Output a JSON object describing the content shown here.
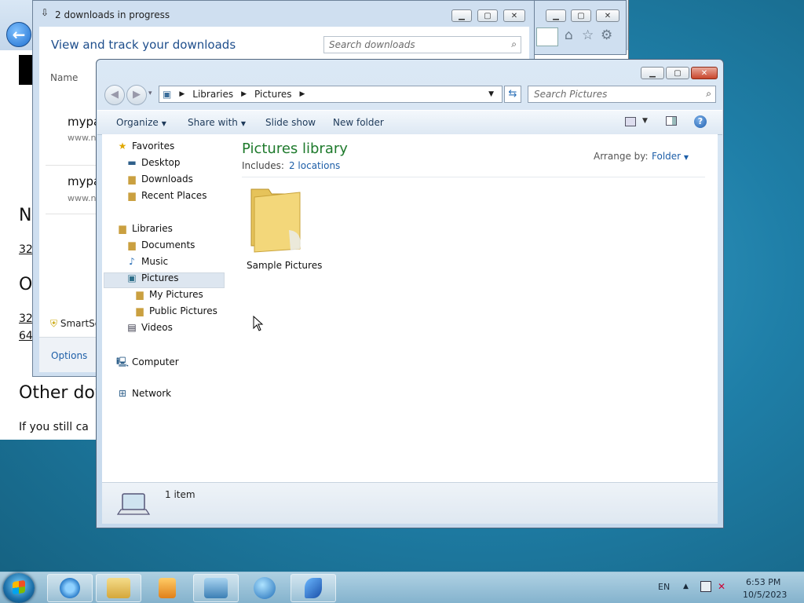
{
  "browser": {
    "heading_n": "N",
    "link_32a": "32",
    "heading_o": "O",
    "link_32b": "32",
    "link_64": "64",
    "other_downloads": "Other dov",
    "still_text": "If you still ca"
  },
  "downloads_window": {
    "title": "2 downloads in progress",
    "heading": "View and track your downloads",
    "search_placeholder": "Search downloads",
    "column_name": "Name",
    "items": [
      {
        "name": "mypa",
        "source": "www.n"
      },
      {
        "name": "mypa",
        "source": "www.n"
      }
    ],
    "smartscreen": "SmartSc",
    "options": "Options"
  },
  "explorer": {
    "breadcrumb": [
      "Libraries",
      "Pictures"
    ],
    "search_placeholder": "Search Pictures",
    "commands": [
      "Organize",
      "Share with",
      "Slide show",
      "New folder"
    ],
    "nav": {
      "favorites": "Favorites",
      "desktop": "Desktop",
      "downloads": "Downloads",
      "recent": "Recent Places",
      "libraries": "Libraries",
      "documents": "Documents",
      "music": "Music",
      "pictures": "Pictures",
      "my_pictures": "My Pictures",
      "public_pictures": "Public Pictures",
      "videos": "Videos",
      "computer": "Computer",
      "network": "Network"
    },
    "library_title": "Pictures library",
    "includes_label": "Includes:",
    "includes_link": "2 locations",
    "arrange_label": "Arrange by:",
    "arrange_value": "Folder",
    "folder_name": "Sample Pictures",
    "item_count": "1 item"
  },
  "taskbar": {
    "lang": "EN",
    "time": "6:53 PM",
    "date": "10/5/2023"
  },
  "colors": {
    "accent": "#1e5fa8",
    "library_title": "#1e7a2c"
  }
}
